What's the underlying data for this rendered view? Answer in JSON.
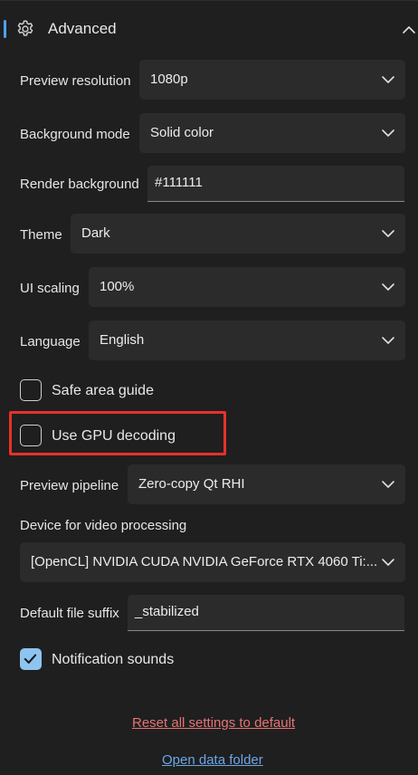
{
  "header": {
    "title": "Advanced"
  },
  "fields": {
    "preview_resolution": {
      "label": "Preview resolution",
      "value": "1080p"
    },
    "background_mode": {
      "label": "Background mode",
      "value": "Solid color"
    },
    "render_background": {
      "label": "Render background",
      "value": "#111111"
    },
    "theme": {
      "label": "Theme",
      "value": "Dark"
    },
    "ui_scaling": {
      "label": "UI scaling",
      "value": "100%"
    },
    "language": {
      "label": "Language",
      "value": "English"
    },
    "preview_pipeline": {
      "label": "Preview pipeline",
      "value": "Zero-copy Qt RHI"
    },
    "device": {
      "label": "Device for video processing",
      "value": "[OpenCL] NVIDIA CUDA NVIDIA GeForce RTX 4060 Ti:..."
    },
    "file_suffix": {
      "label": "Default file suffix",
      "value": "_stabilized"
    }
  },
  "checkboxes": {
    "safe_area": {
      "label": "Safe area guide",
      "checked": false
    },
    "gpu_decoding": {
      "label": "Use GPU decoding",
      "checked": false
    },
    "notification_sounds": {
      "label": "Notification sounds",
      "checked": true
    }
  },
  "links": {
    "reset": "Reset all settings to default",
    "open_folder": "Open data folder"
  },
  "colors": {
    "accent": "#4aa3ff",
    "checkbox_checked": "#8ec4f0",
    "highlight": "#e8312a"
  }
}
